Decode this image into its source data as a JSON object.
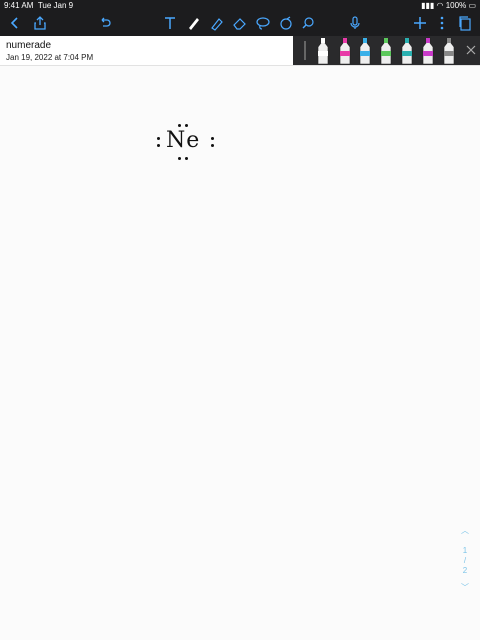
{
  "status": {
    "time": "9:41 AM",
    "date": "Tue Jan 9",
    "battery": "100%"
  },
  "document": {
    "title": "numerade",
    "date": "Jan 19, 2022 at 7:04 PM"
  },
  "canvas": {
    "element_symbol": "Ne"
  },
  "pager": {
    "current": "1",
    "separator": "/",
    "total": "2"
  },
  "pen_colors": [
    "#ffffff",
    "#e83aa8",
    "#3ab0e8",
    "#5cc85c",
    "#2ab0b0",
    "#c83ac8",
    "#888888"
  ]
}
